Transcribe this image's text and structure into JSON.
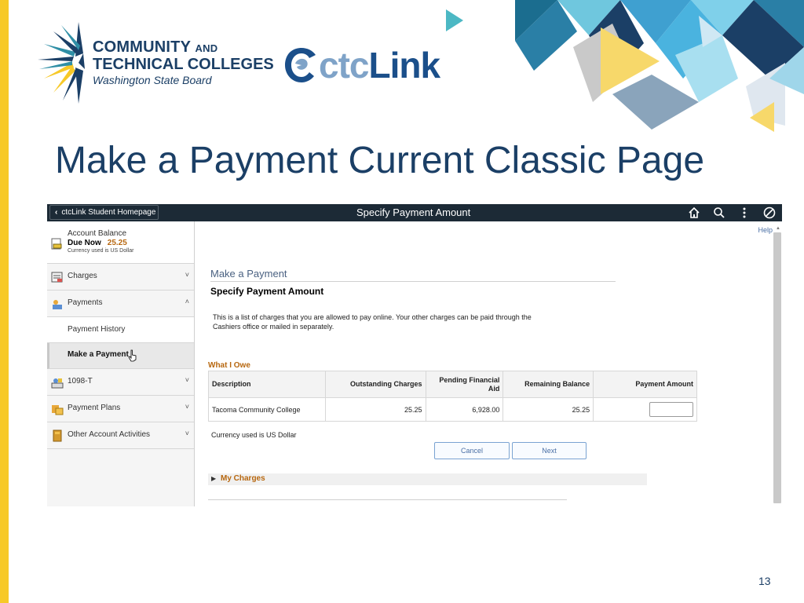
{
  "slide": {
    "title": "Make a Payment Current Classic Page",
    "page_number": "13"
  },
  "logos": {
    "sbctc_line1": "COMMUNITY",
    "sbctc_and": "AND",
    "sbctc_line2": "TECHNICAL COLLEGES",
    "sbctc_line3": "Washington State Board",
    "ctclink_ctc": "ctc",
    "ctclink_link": "Link"
  },
  "screenshot": {
    "header": {
      "back_label": "ctcLink Student Homepage",
      "title": "Specify Payment Amount",
      "icons": [
        "home-icon",
        "search-icon",
        "more-vertical-icon",
        "navbar-compass-icon"
      ]
    },
    "sidebar": {
      "account_balance": {
        "title": "Account Balance",
        "due_label": "Due Now",
        "due_amount": "25.25",
        "currency_note": "Currency used is US Dollar"
      },
      "items": [
        {
          "label": "Charges",
          "icon": "charges-icon",
          "caret": "˅"
        },
        {
          "label": "Payments",
          "icon": "payments-icon",
          "caret": "˄"
        },
        {
          "label": "Payment History"
        },
        {
          "label": "Make a Payment"
        },
        {
          "label": "1098-T",
          "icon": "tax-form-icon",
          "caret": "˅"
        },
        {
          "label": "Payment Plans",
          "icon": "payment-plans-icon",
          "caret": "˅"
        },
        {
          "label": "Other Account Activities",
          "icon": "folder-icon",
          "caret": "˅"
        }
      ]
    },
    "main": {
      "help_link": "Help",
      "breadcrumb": "Make a Payment",
      "section_title": "Specify Payment Amount",
      "instructions": "This is a list of charges that you are allowed to pay online. Your other charges can be paid through the Cashiers office or mailed in separately.",
      "owe_title": "What I Owe",
      "columns": [
        "Description",
        "Outstanding Charges",
        "Pending Financial Aid",
        "Remaining Balance",
        "Payment Amount"
      ],
      "rows": [
        {
          "description": "Tacoma Community College",
          "outstanding": "25.25",
          "pending_aid": "6,928.00",
          "remaining": "25.25",
          "payment_amount": ""
        }
      ],
      "currency_note": "Currency used is US Dollar",
      "cancel_label": "Cancel",
      "next_label": "Next",
      "my_charges_label": "My Charges"
    }
  },
  "colors": {
    "title_navy": "#1b3f66",
    "accent_yellow": "#f7c928",
    "header_dark": "#1c2a36",
    "link_orange": "#b7670f"
  }
}
